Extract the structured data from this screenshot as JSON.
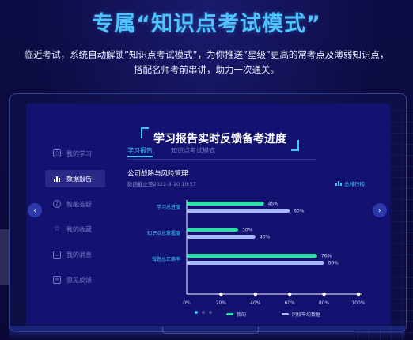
{
  "hero": {
    "title": "专属“知识点考试模式”",
    "desc_line1": "临近考试，系统自动解锁“知识点考试模式”，为你推送“星级”更高的常考点及薄弱知识点，",
    "desc_line2": "搭配名师考前串讲，助力一次通关。"
  },
  "panel": {
    "title": "学习报告实时反馈备考进度"
  },
  "sidebar": {
    "items": [
      {
        "label": "我的学习",
        "icon": "book-icon"
      },
      {
        "label": "数据报告",
        "icon": "bar-chart-icon",
        "active": true
      },
      {
        "label": "智能答疑",
        "icon": "question-icon"
      },
      {
        "label": "我的收藏",
        "icon": "star-icon"
      },
      {
        "label": "我的消息",
        "icon": "message-icon"
      },
      {
        "label": "意见反馈",
        "icon": "feedback-icon"
      }
    ]
  },
  "tabs": [
    {
      "label": "学习报告",
      "active": true
    },
    {
      "label": "知识点考试模式",
      "active": false
    }
  ],
  "report": {
    "subject": "公司战略与风险管理",
    "data_date": "数据截止至2021-3-10  10:57",
    "link_label": "总排行榜"
  },
  "chart_data": {
    "type": "bar",
    "orientation": "horizontal",
    "categories": [
      "学习总进度",
      "知识点总掌握度",
      "做题总正确率"
    ],
    "series": [
      {
        "name": "我的",
        "values": [
          45,
          30,
          76
        ],
        "color": "#2ee0a8"
      },
      {
        "name": "同校平均数据",
        "values": [
          60,
          40,
          80
        ],
        "color": "#a9b8ff"
      }
    ],
    "value_labels": [
      [
        "45%",
        "60%"
      ],
      [
        "30%",
        "40%"
      ],
      [
        "76%",
        "80%"
      ]
    ],
    "xticks": [
      "0%",
      "20%",
      "40%",
      "60%",
      "80%",
      "100%"
    ],
    "xlim": [
      0,
      100
    ],
    "legend_position": "bottom"
  },
  "carousel": {
    "pages": 3,
    "active": 0
  },
  "colors": {
    "accent": "#3ec8ff",
    "title": "#4fc3ff",
    "green": "#2ee0a8",
    "lavender": "#a9b8ff"
  }
}
